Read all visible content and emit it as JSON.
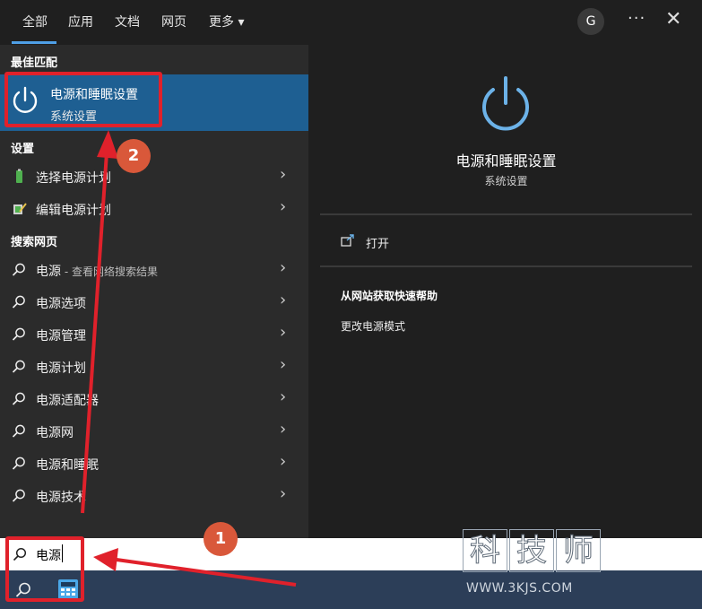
{
  "tabs": [
    "全部",
    "应用",
    "文档",
    "网页",
    "更多 ▾"
  ],
  "header": {
    "avatar_letter": "G",
    "more_dots": "···",
    "close_glyph": "✕"
  },
  "sections": {
    "best": "最佳匹配",
    "settings": "设置",
    "search_web": "搜索网页"
  },
  "best_match": {
    "title": "电源和睡眠设置",
    "subtitle": "系统设置",
    "icon": "power-icon"
  },
  "settings_items": [
    {
      "label": "选择电源计划",
      "icon": "battery-plan-icon"
    },
    {
      "label": "编辑电源计划",
      "icon": "edit-plan-icon"
    }
  ],
  "web_items": [
    {
      "label": "电源",
      "suffix": " - 查看网络搜索结果"
    },
    {
      "label": "电源选项",
      "suffix": ""
    },
    {
      "label": "电源管理",
      "suffix": ""
    },
    {
      "label": "电源计划",
      "suffix": ""
    },
    {
      "label": "电源适配器",
      "suffix": ""
    },
    {
      "label": "电源网",
      "suffix": ""
    },
    {
      "label": "电源和睡眠",
      "suffix": ""
    },
    {
      "label": "电源技术",
      "suffix": ""
    }
  ],
  "preview": {
    "title": "电源和睡眠设置",
    "subtitle": "系统设置",
    "open_label": "打开",
    "help_title": "从网站获取快速帮助",
    "help_link": "更改电源模式"
  },
  "search": {
    "value": "电源"
  },
  "annotations": {
    "badge_1": "1",
    "badge_2": "2"
  },
  "watermark": {
    "chars": [
      "科",
      "技",
      "师"
    ],
    "url": "WWW.3KJS.COM"
  },
  "colors": {
    "accent": "#1e5f92",
    "annotation_red": "#e0212b",
    "badge": "#d9583a",
    "tab_underline": "#4f9fe6"
  }
}
